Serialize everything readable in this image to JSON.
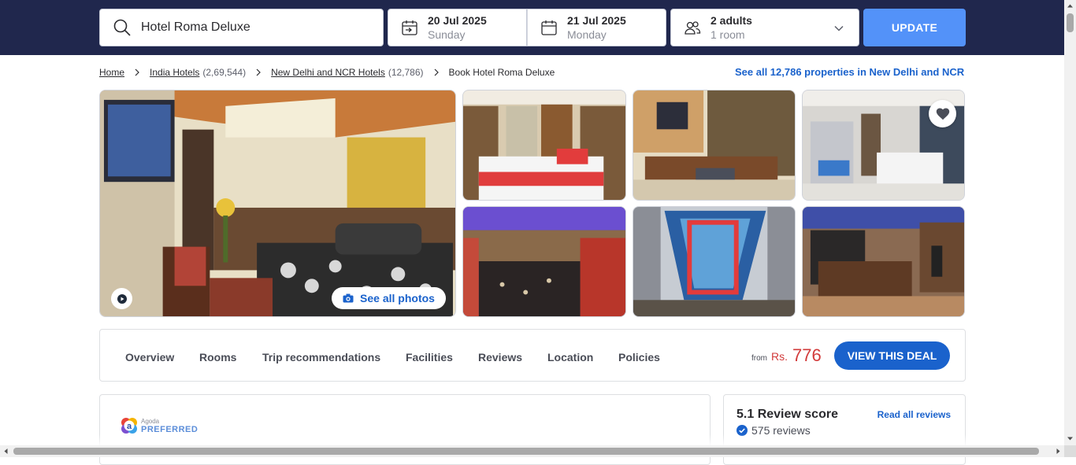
{
  "search": {
    "query": "Hotel Roma Deluxe",
    "checkin_date": "20 Jul 2025",
    "checkin_day": "Sunday",
    "checkout_date": "21 Jul 2025",
    "checkout_day": "Monday",
    "guests": "2 adults",
    "rooms": "1 room",
    "update_label": "UPDATE",
    "icons": [
      "search-icon",
      "checkin-calendar-icon",
      "checkout-calendar-icon",
      "guests-icon",
      "chevron-down-icon"
    ]
  },
  "breadcrumb": {
    "home": "Home",
    "country": "India Hotels",
    "country_count": "(2,69,544)",
    "city": "New Delhi and NCR Hotels",
    "city_count": "(12,786)",
    "current": "Book Hotel Roma Deluxe",
    "see_all": "See all 12,786 properties in New Delhi and NCR"
  },
  "gallery": {
    "see_all_photos": "See all photos",
    "photos": [
      "hotel-room-main",
      "double-bed-room",
      "sitting-room",
      "reception-lobby",
      "hotel-bar",
      "hotel-facade",
      "bar-lounge"
    ]
  },
  "nav": {
    "tabs": [
      "Overview",
      "Rooms",
      "Trip recommendations",
      "Facilities",
      "Reviews",
      "Location",
      "Policies"
    ],
    "from_label": "from",
    "currency": "Rs.",
    "price": "776",
    "deal_button": "VIEW THIS DEAL"
  },
  "badge": {
    "line1": "Agoda",
    "line2": "PREFERRED"
  },
  "reviews": {
    "score_title": "5.1 Review score",
    "read_all": "Read all reviews",
    "count": "575 reviews"
  },
  "colors": {
    "header_bg": "#20274d",
    "update_button": "#5392f9",
    "link_blue": "#1a62cc",
    "price_red": "#d23a3a"
  }
}
